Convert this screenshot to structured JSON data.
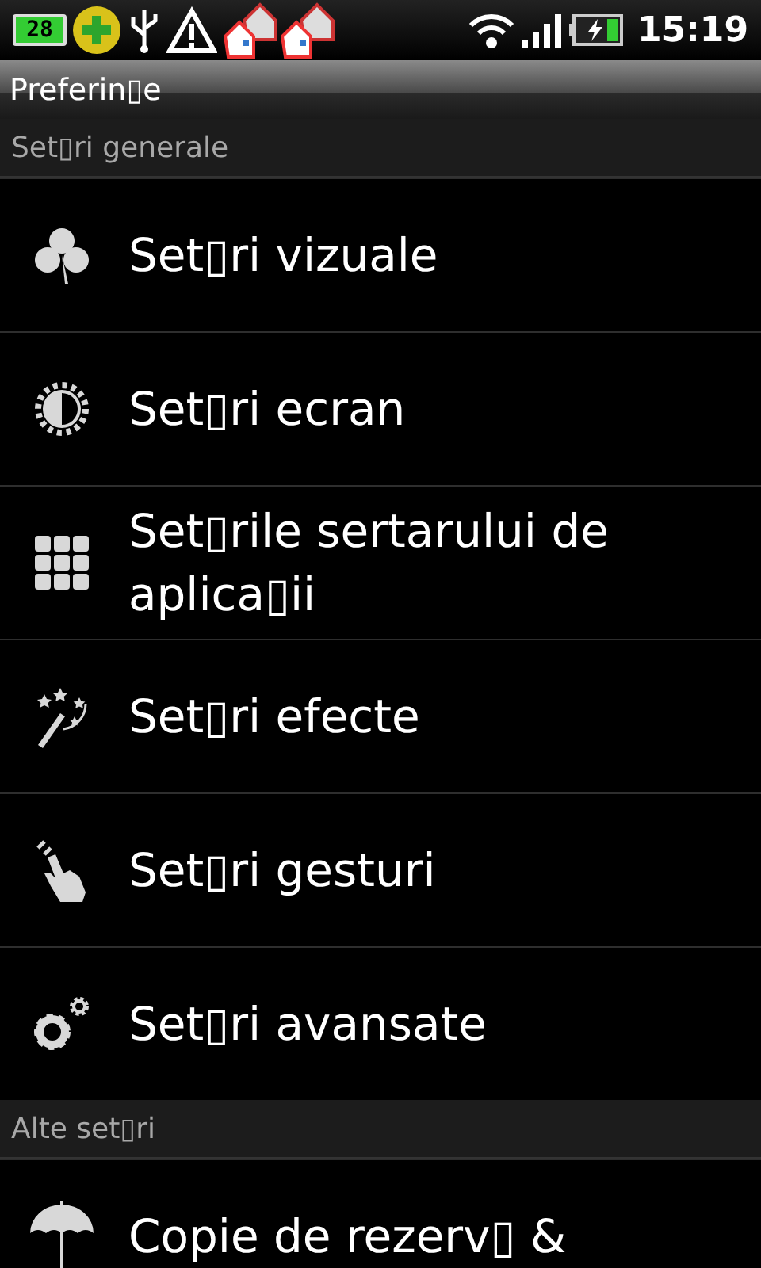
{
  "status_bar": {
    "badge": "28",
    "time": "15:19"
  },
  "title": "Preferin▯e",
  "sections": [
    {
      "header": "Set▯ri generale",
      "items": [
        {
          "label": "Set▯ri vizuale"
        },
        {
          "label": "Set▯ri ecran"
        },
        {
          "label": "Set▯rile sertarului de aplica▯ii"
        },
        {
          "label": "Set▯ri efecte"
        },
        {
          "label": "Set▯ri gesturi"
        },
        {
          "label": "Set▯ri avansate"
        }
      ]
    },
    {
      "header": "Alte set▯ri",
      "items": [
        {
          "label": "Copie de rezerv▯ &"
        }
      ]
    }
  ]
}
